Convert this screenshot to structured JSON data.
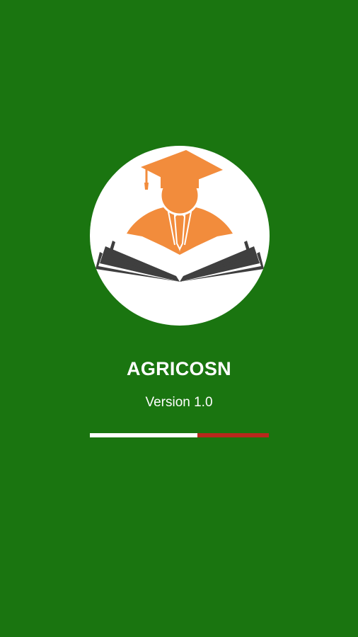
{
  "splash": {
    "app_name": "AGRICOSN",
    "version": "Version 1.0",
    "logo_icon": "graduate-reading-book-icon"
  },
  "progress": {
    "value": 0.6,
    "fill_color": "#ffffff",
    "track_color": "#b8281c"
  },
  "colors": {
    "background": "#1a7510",
    "logo_accent": "#f28c3c",
    "logo_book": "#3f3f3f"
  }
}
